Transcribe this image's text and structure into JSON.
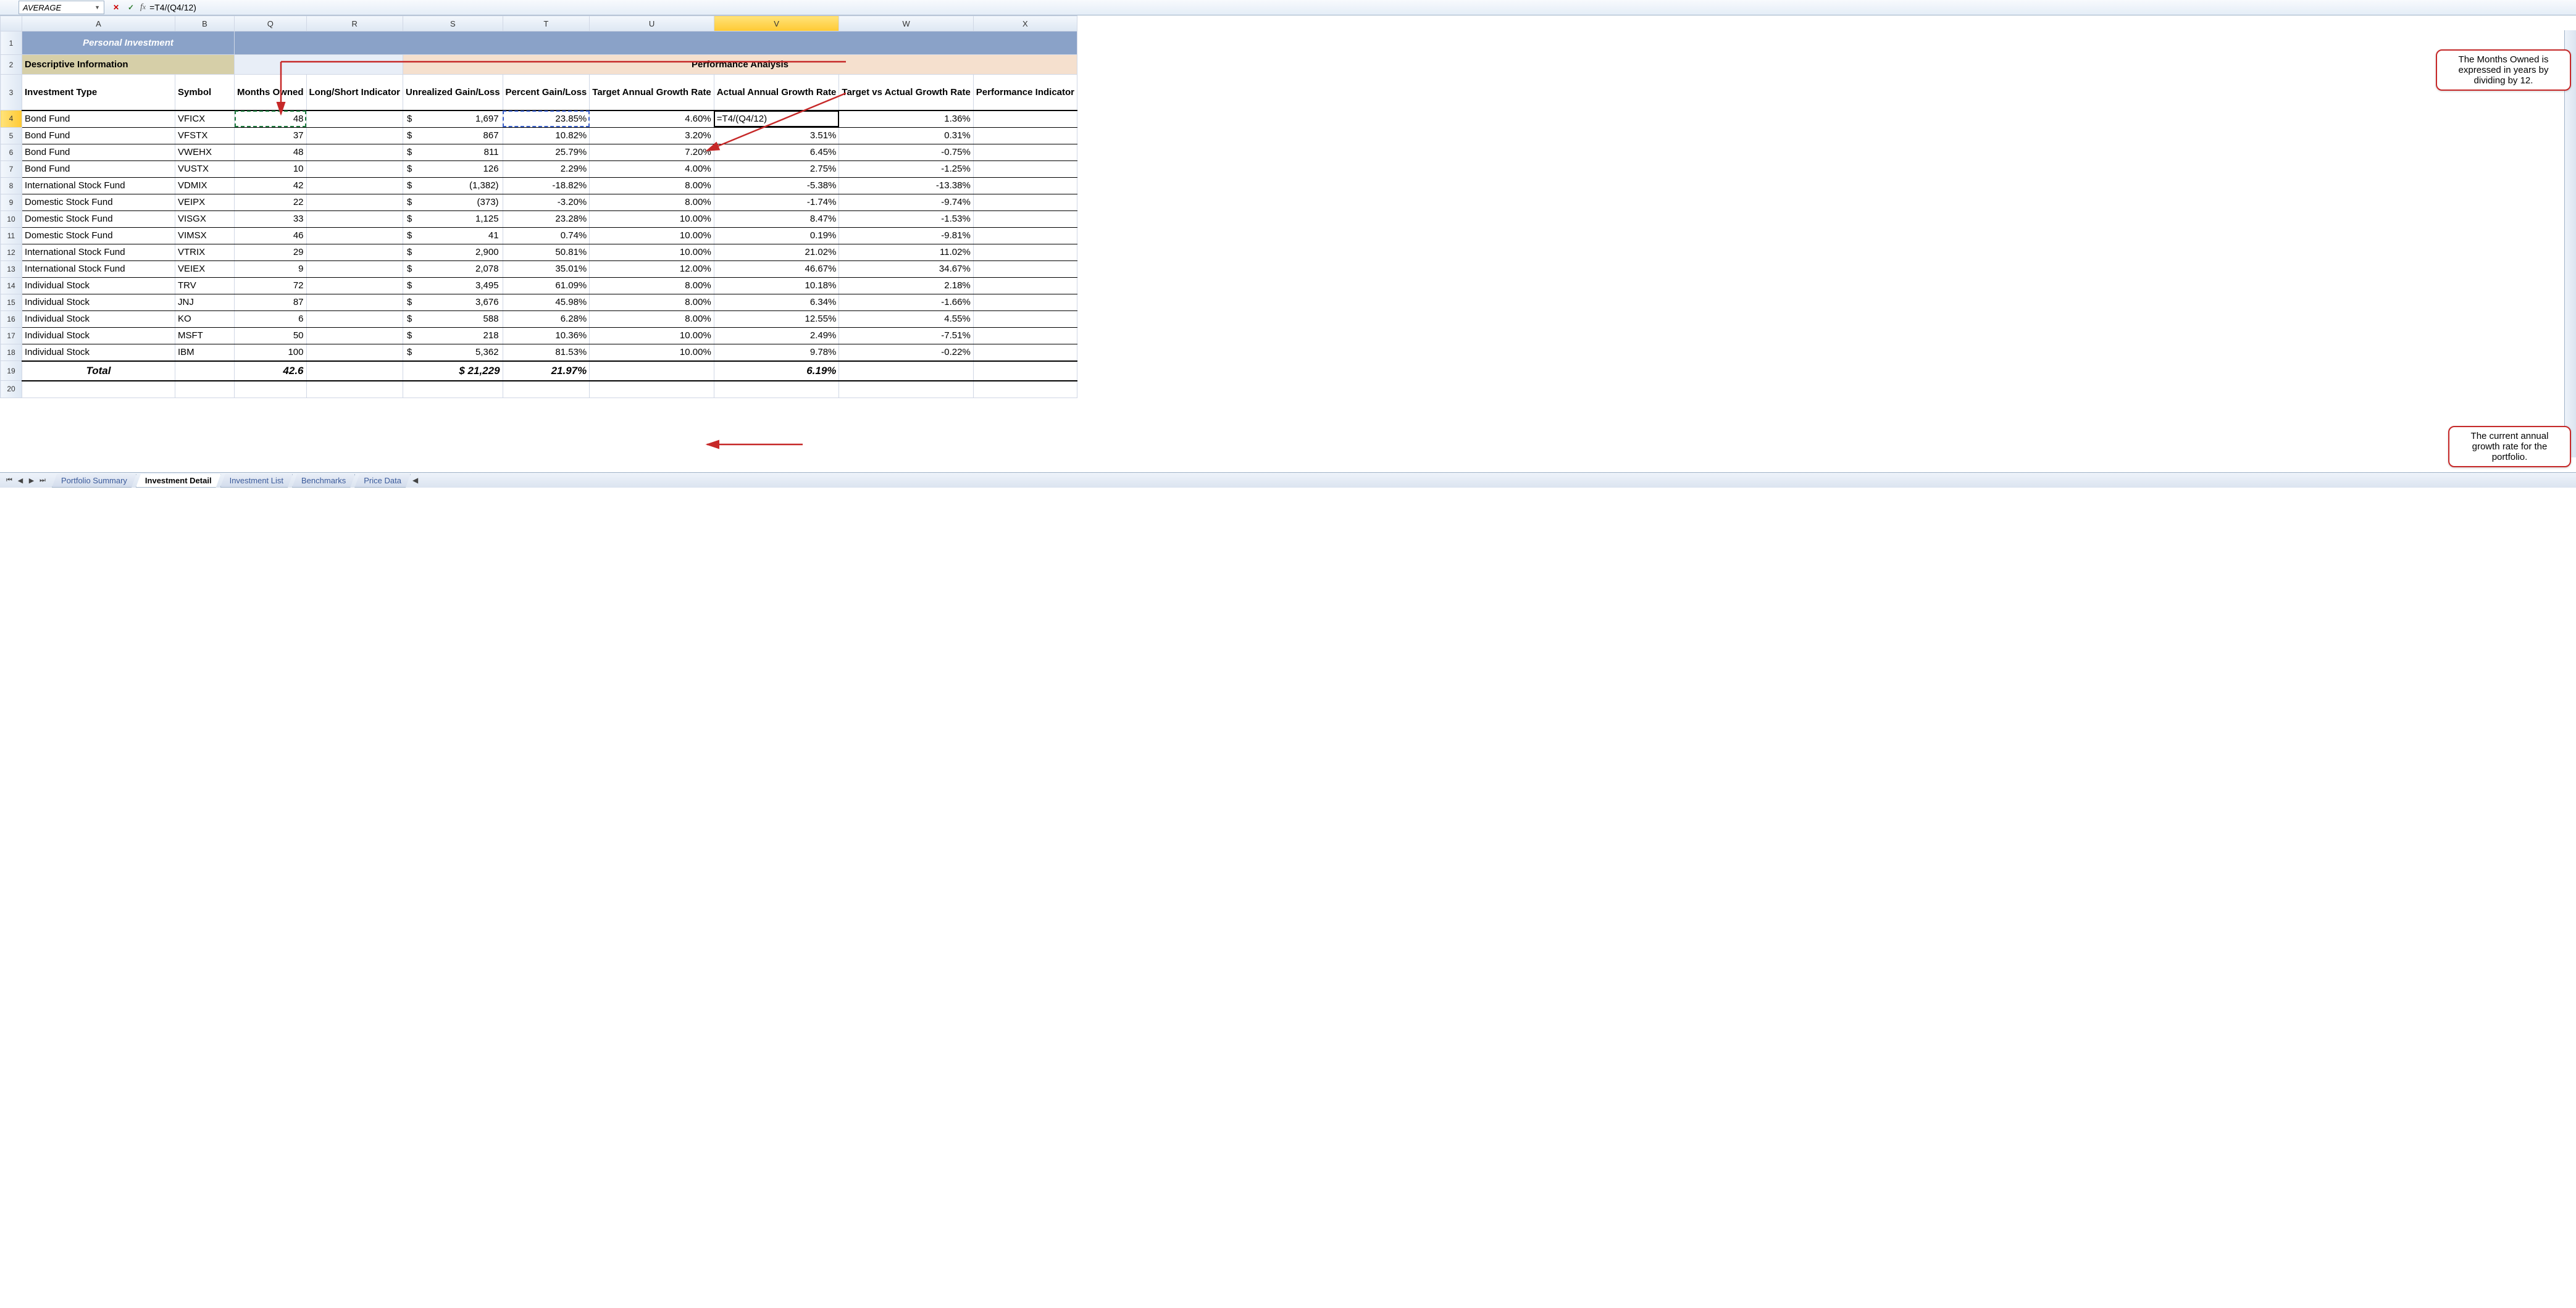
{
  "namebox": "AVERAGE",
  "formula": "=T4/(Q4/12)",
  "columns": [
    "",
    "A",
    "B",
    "Q",
    "R",
    "S",
    "T",
    "U",
    "V",
    "W",
    "X"
  ],
  "selected_col": "V",
  "row_labels": [
    "1",
    "2",
    "3",
    "4",
    "5",
    "6",
    "7",
    "8",
    "9",
    "10",
    "11",
    "12",
    "13",
    "14",
    "15",
    "16",
    "17",
    "18",
    "19",
    "20"
  ],
  "selected_row": "4",
  "banner": "Personal Investment",
  "section_left": "Descriptive Information",
  "section_right": "Performance Analysis",
  "headers": {
    "A": "Investment Type",
    "B": "Symbol",
    "Q": "Months Owned",
    "R": "Long/Short Indicator",
    "S": "Unrealized Gain/Loss",
    "T": "Percent Gain/Loss",
    "U": "Target Annual Growth Rate",
    "V": "Actual Annual Growth Rate",
    "W": "Target vs Actual Growth Rate",
    "X": "Performance Indicator"
  },
  "rows": [
    {
      "A": "Bond Fund",
      "B": "VFICX",
      "Q": "48",
      "S": "1,697",
      "T": "23.85%",
      "U": "4.60%",
      "V": "=T4/(Q4/12)",
      "W": "1.36%"
    },
    {
      "A": "Bond Fund",
      "B": "VFSTX",
      "Q": "37",
      "S": "867",
      "T": "10.82%",
      "U": "3.20%",
      "V": "3.51%",
      "W": "0.31%"
    },
    {
      "A": "Bond Fund",
      "B": "VWEHX",
      "Q": "48",
      "S": "811",
      "T": "25.79%",
      "U": "7.20%",
      "V": "6.45%",
      "W": "-0.75%"
    },
    {
      "A": "Bond Fund",
      "B": "VUSTX",
      "Q": "10",
      "S": "126",
      "T": "2.29%",
      "U": "4.00%",
      "V": "2.75%",
      "W": "-1.25%"
    },
    {
      "A": "International Stock Fund",
      "B": "VDMIX",
      "Q": "42",
      "S": "(1,382)",
      "T": "-18.82%",
      "U": "8.00%",
      "V": "-5.38%",
      "W": "-13.38%"
    },
    {
      "A": "Domestic Stock Fund",
      "B": "VEIPX",
      "Q": "22",
      "S": "(373)",
      "T": "-3.20%",
      "U": "8.00%",
      "V": "-1.74%",
      "W": "-9.74%"
    },
    {
      "A": "Domestic Stock Fund",
      "B": "VISGX",
      "Q": "33",
      "S": "1,125",
      "T": "23.28%",
      "U": "10.00%",
      "V": "8.47%",
      "W": "-1.53%"
    },
    {
      "A": "Domestic Stock Fund",
      "B": "VIMSX",
      "Q": "46",
      "S": "41",
      "T": "0.74%",
      "U": "10.00%",
      "V": "0.19%",
      "W": "-9.81%"
    },
    {
      "A": "International Stock Fund",
      "B": "VTRIX",
      "Q": "29",
      "S": "2,900",
      "T": "50.81%",
      "U": "10.00%",
      "V": "21.02%",
      "W": "11.02%"
    },
    {
      "A": "International Stock Fund",
      "B": "VEIEX",
      "Q": "9",
      "S": "2,078",
      "T": "35.01%",
      "U": "12.00%",
      "V": "46.67%",
      "W": "34.67%"
    },
    {
      "A": "Individual Stock",
      "B": "TRV",
      "Q": "72",
      "S": "3,495",
      "T": "61.09%",
      "U": "8.00%",
      "V": "10.18%",
      "W": "2.18%"
    },
    {
      "A": "Individual Stock",
      "B": "JNJ",
      "Q": "87",
      "S": "3,676",
      "T": "45.98%",
      "U": "8.00%",
      "V": "6.34%",
      "W": "-1.66%"
    },
    {
      "A": "Individual Stock",
      "B": "KO",
      "Q": "6",
      "S": "588",
      "T": "6.28%",
      "U": "8.00%",
      "V": "12.55%",
      "W": "4.55%"
    },
    {
      "A": "Individual Stock",
      "B": "MSFT",
      "Q": "50",
      "S": "218",
      "T": "10.36%",
      "U": "10.00%",
      "V": "2.49%",
      "W": "-7.51%"
    },
    {
      "A": "Individual Stock",
      "B": "IBM",
      "Q": "100",
      "S": "5,362",
      "T": "81.53%",
      "U": "10.00%",
      "V": "9.78%",
      "W": "-0.22%"
    }
  ],
  "total": {
    "label": "Total",
    "Q": "42.6",
    "S": "$ 21,229",
    "T": "21.97%",
    "V": "6.19%"
  },
  "callout1": "The Months Owned is expressed in years by dividing by 12.",
  "callout2": "The current annual growth rate for the portfolio.",
  "tabs": [
    "Portfolio Summary",
    "Investment Detail",
    "Investment List",
    "Benchmarks",
    "Price Data"
  ],
  "active_tab": "Investment Detail"
}
